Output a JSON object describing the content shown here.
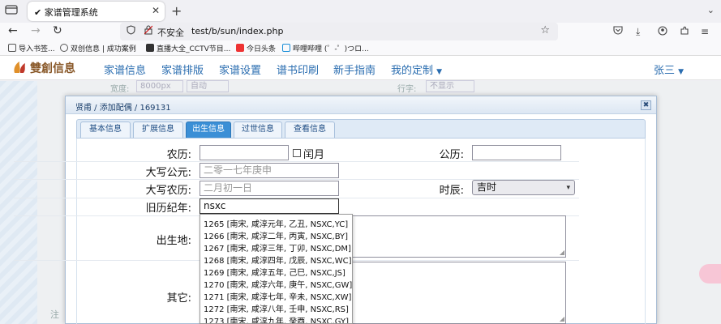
{
  "browser": {
    "tab_title": "✔ 家谱管理系统",
    "url_insecure_label": "不安全",
    "url": "test/b/sun/index.php",
    "bookmarks": [
      "导入书签...",
      "双创信息 | 成功案例",
      "直播大全_CCTV节目...",
      "今日头条",
      "哔哩哔哩 (゜-゜)つロ..."
    ]
  },
  "app": {
    "logo_text": "雙創信息",
    "menu": [
      "家谱信息",
      "家谱排版",
      "家谱设置",
      "谱书印刷",
      "新手指南",
      "我的定制"
    ],
    "user": "张三"
  },
  "background": {
    "width_label": "宽度:",
    "width_value": "8000px",
    "auto_value": "自动",
    "font_label": "行字:",
    "font_value": "不显示",
    "note": "注"
  },
  "modal": {
    "breadcrumb": "贤甫 / 添加配偶 / 169131",
    "close_label": "✖",
    "tabs": [
      "基本信息",
      "扩展信息",
      "出生信息",
      "过世信息",
      "查看信息"
    ],
    "active_tab": 2,
    "form": {
      "nongli_label": "农历:",
      "nongli_value": "",
      "run_yue_label": "闰月",
      "gongli_label": "公历:",
      "gongli_value": "",
      "daxie_gongyuan_label": "大写公元:",
      "daxie_gongyuan_placeholder": "二零一七年庚申",
      "daxie_nongli_label": "大写农历:",
      "daxie_nongli_placeholder": "二月初一日",
      "shichen_label": "时辰:",
      "shichen_value": "吉时",
      "jiuli_label": "旧历纪年:",
      "jiuli_value": "nsxc",
      "birthplace_label": "出生地:",
      "other_label": "其它:"
    },
    "autocomplete": [
      "1265 [南宋, 咸淳元年, 乙丑, NSXC,YC]",
      "1266 [南宋, 咸淳二年, 丙寅, NSXC,BY]",
      "1267 [南宋, 咸淳三年, 丁卯, NSXC,DM]",
      "1268 [南宋, 咸淳四年, 戊辰, NSXC,WC]",
      "1269 [南宋, 咸淳五年, 己巳, NSXC,JS]",
      "1270 [南宋, 咸淳六年, 庚午, NSXC,GW]",
      "1271 [南宋, 咸淳七年, 辛未, NSXC,XW]",
      "1272 [南宋, 咸淳八年, 壬申, NSXC,RS]",
      "1273 [南宋, 咸淳九年, 癸酉, NSXC,GY]"
    ]
  }
}
